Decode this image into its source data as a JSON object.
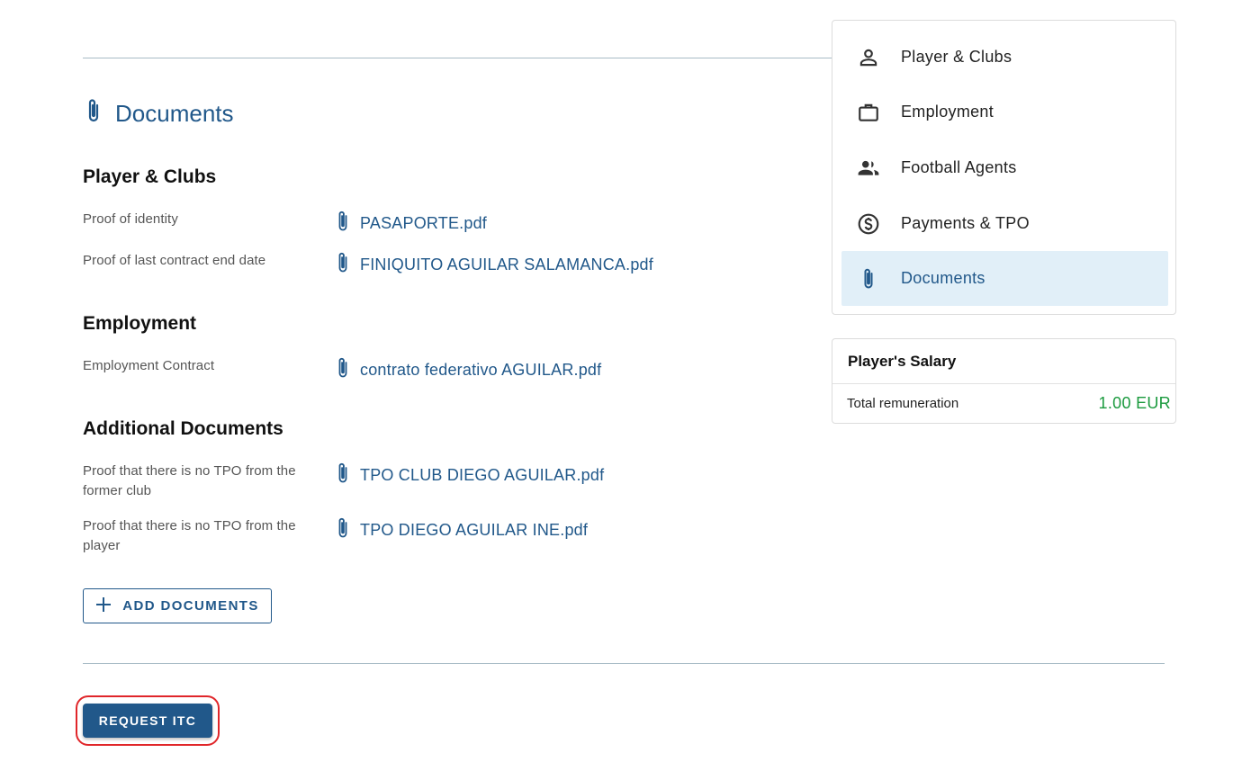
{
  "documents_section": {
    "title": "Documents",
    "title_icon": "paperclip-icon",
    "groups": [
      {
        "title": "Player & Clubs",
        "items": [
          {
            "label": "Proof of identity",
            "file": "PASAPORTE.pdf"
          },
          {
            "label": "Proof of last contract end date",
            "file": "FINIQUITO AGUILAR SALAMANCA.pdf"
          }
        ]
      },
      {
        "title": "Employment",
        "items": [
          {
            "label": "Employment Contract",
            "file": "contrato federativo AGUILAR.pdf"
          }
        ]
      },
      {
        "title": "Additional Documents",
        "items": [
          {
            "label": "Proof that there is no TPO from the former club",
            "file": "TPO CLUB DIEGO AGUILAR.pdf"
          },
          {
            "label": "Proof that there is no TPO from the player",
            "file": "TPO DIEGO AGUILAR INE.pdf"
          }
        ]
      }
    ],
    "add_button": {
      "label": "ADD DOCUMENTS",
      "icon": "plus-icon"
    }
  },
  "request_button": {
    "label": "REQUEST ITC"
  },
  "nav": {
    "items": [
      {
        "label": "Player & Clubs",
        "icon": "person-icon",
        "active": false
      },
      {
        "label": "Employment",
        "icon": "briefcase-icon",
        "active": false
      },
      {
        "label": "Football Agents",
        "icon": "people-icon",
        "active": false
      },
      {
        "label": "Payments & TPO",
        "icon": "dollar-circle-icon",
        "active": false
      },
      {
        "label": "Documents",
        "icon": "paperclip-icon",
        "active": true
      }
    ]
  },
  "salary": {
    "title": "Player's Salary",
    "total_label": "Total remuneration",
    "total_value": "1.00 EUR"
  },
  "colors": {
    "primary": "#21588a",
    "active_bg": "#e1eff8",
    "amount_green": "#1b9a3e",
    "highlight_red": "#e0262a"
  }
}
